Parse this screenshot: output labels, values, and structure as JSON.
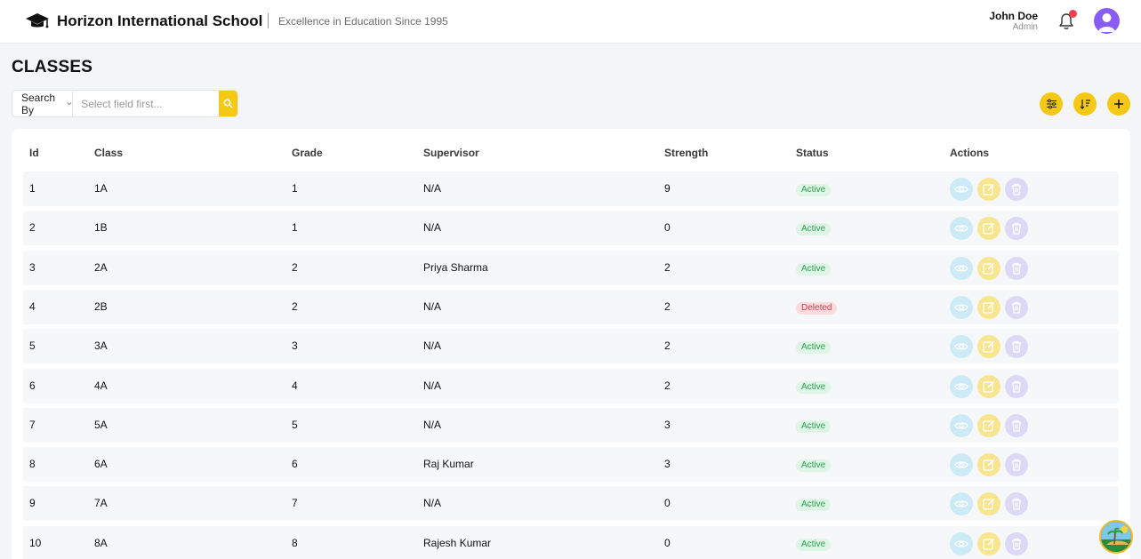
{
  "header": {
    "school_name": "Horizon International School",
    "tagline": "Excellence in Education Since 1995",
    "user_name": "John Doe",
    "user_role": "Admin"
  },
  "page": {
    "title": "CLASSES"
  },
  "search": {
    "by_label": "Search By",
    "placeholder": "Select field first..."
  },
  "table": {
    "columns": [
      "Id",
      "Class",
      "Grade",
      "Supervisor",
      "Strength",
      "Status",
      "Actions"
    ],
    "rows": [
      {
        "id": "1",
        "class": "1A",
        "grade": "1",
        "supervisor": "N/A",
        "strength": "9",
        "status": "Active"
      },
      {
        "id": "2",
        "class": "1B",
        "grade": "1",
        "supervisor": "N/A",
        "strength": "0",
        "status": "Active"
      },
      {
        "id": "3",
        "class": "2A",
        "grade": "2",
        "supervisor": "Priya Sharma",
        "strength": "2",
        "status": "Active"
      },
      {
        "id": "4",
        "class": "2B",
        "grade": "2",
        "supervisor": "N/A",
        "strength": "2",
        "status": "Deleted"
      },
      {
        "id": "5",
        "class": "3A",
        "grade": "3",
        "supervisor": "N/A",
        "strength": "2",
        "status": "Active"
      },
      {
        "id": "6",
        "class": "4A",
        "grade": "4",
        "supervisor": "N/A",
        "strength": "2",
        "status": "Active"
      },
      {
        "id": "7",
        "class": "5A",
        "grade": "5",
        "supervisor": "N/A",
        "strength": "3",
        "status": "Active"
      },
      {
        "id": "8",
        "class": "6A",
        "grade": "6",
        "supervisor": "Raj Kumar",
        "strength": "3",
        "status": "Active"
      },
      {
        "id": "9",
        "class": "7A",
        "grade": "7",
        "supervisor": "N/A",
        "strength": "0",
        "status": "Active"
      },
      {
        "id": "10",
        "class": "8A",
        "grade": "8",
        "supervisor": "Rajesh Kumar",
        "strength": "0",
        "status": "Active"
      }
    ]
  },
  "colors": {
    "accent": "#f6c816",
    "avatar": "#8a5cf6",
    "active_badge_bg": "#dff5e6",
    "active_badge_text": "#2aa04f",
    "deleted_badge_bg": "#fbdde0",
    "deleted_badge_text": "#d83a4a"
  },
  "icons": {
    "brand": "graduation-cap-icon",
    "notifications": "bell-icon",
    "search": "search-icon",
    "filter": "filter-sliders-icon",
    "sort": "sort-icon",
    "add": "plus-icon",
    "view": "eye-icon",
    "edit": "edit-icon",
    "delete": "trash-icon"
  }
}
